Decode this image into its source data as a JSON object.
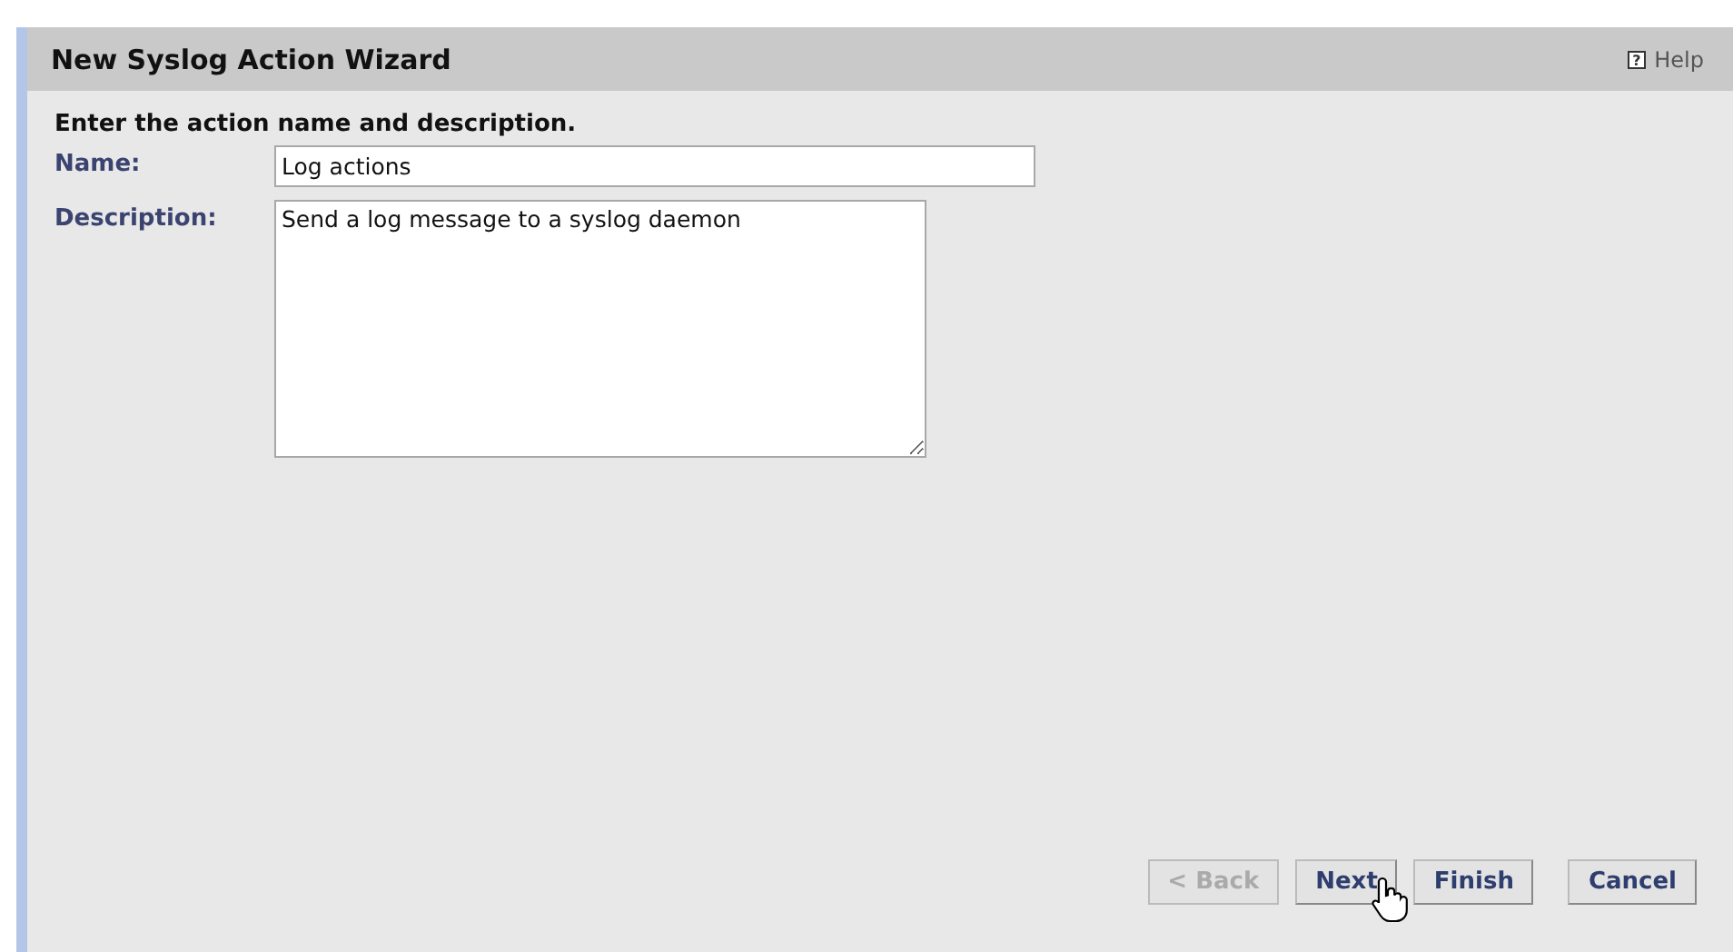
{
  "window": {
    "title": "New Syslog Action Wizard",
    "help_icon": "?",
    "help": "Help"
  },
  "instruction": "Enter the action name and description.",
  "fields": [
    {
      "label": "Name:",
      "kind": "text",
      "value": "Log actions"
    },
    {
      "label": "Description:",
      "kind": "textarea",
      "value": "Send a log message to a syslog daemon"
    }
  ],
  "buttons": [
    {
      "label": "< Back",
      "disabled": true
    },
    {
      "label": "Next",
      "disabled": false
    },
    {
      "label": "Finish",
      "disabled": false
    },
    {
      "label": "Cancel",
      "disabled": false
    }
  ]
}
